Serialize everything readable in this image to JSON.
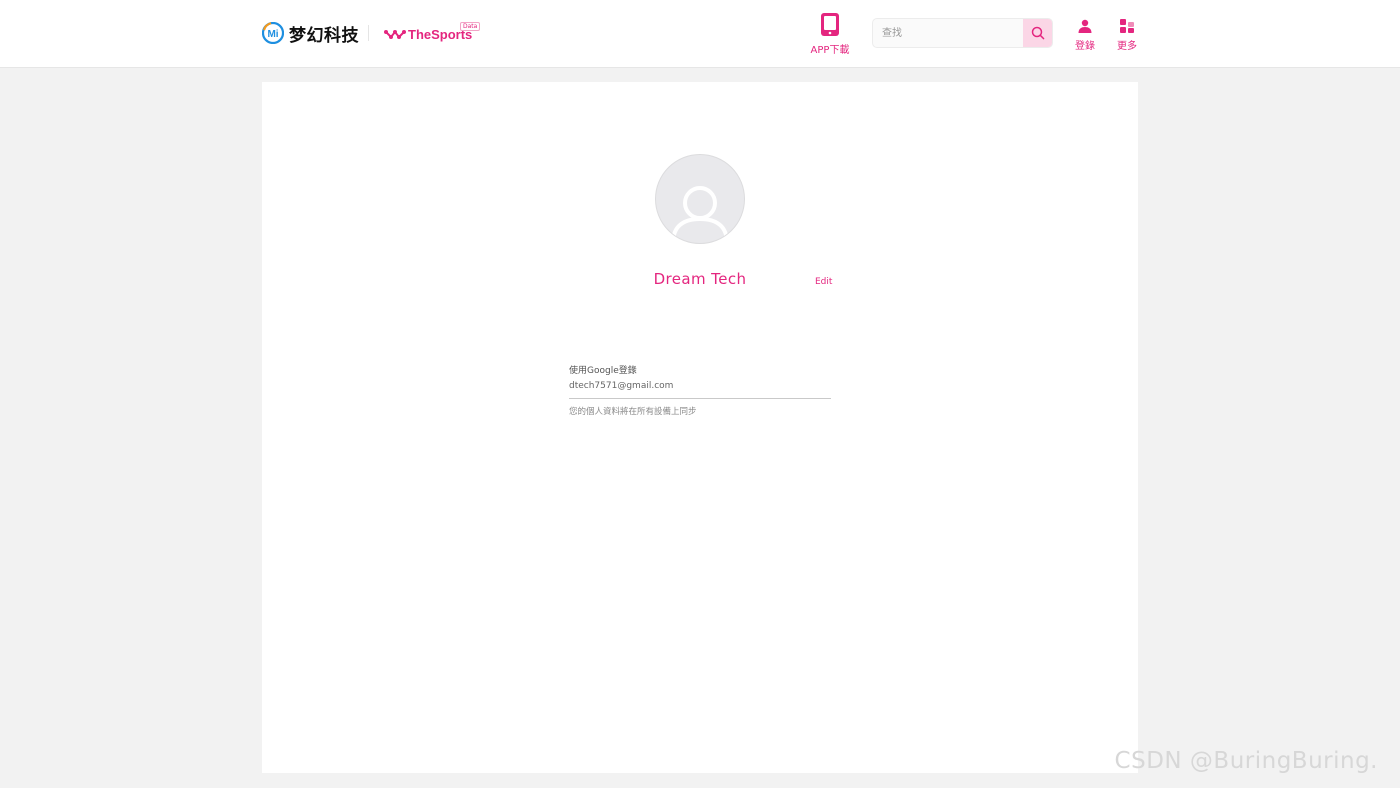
{
  "header": {
    "logo_text": "梦幻科技",
    "logo_badge_letters": "Mi",
    "brand_name": "TheSports",
    "brand_tag": "Data",
    "app_download_label": "APP下載",
    "search": {
      "placeholder": "查找",
      "value": ""
    },
    "login_label": "登錄",
    "more_label": "更多"
  },
  "profile": {
    "display_name": "Dream Tech",
    "edit_label": "Edit",
    "login_method_label": "使用Google登錄",
    "email": "dtech7571@gmail.com",
    "sync_note": "您的個人資料將在所有設備上同步"
  },
  "watermark": "CSDN @BuringBuring.",
  "colors": {
    "accent": "#e4267f",
    "accent_light": "#fbd6e6",
    "page_bg": "#f2f2f2",
    "avatar_bg": "#e9e9ec"
  },
  "icons": {
    "logo": "mi-logo-icon",
    "brand": "thesports-wave-icon",
    "app_download": "tablet-icon",
    "search": "search-icon",
    "login": "user-icon",
    "more": "grid-icon",
    "avatar": "user-avatar-icon"
  }
}
